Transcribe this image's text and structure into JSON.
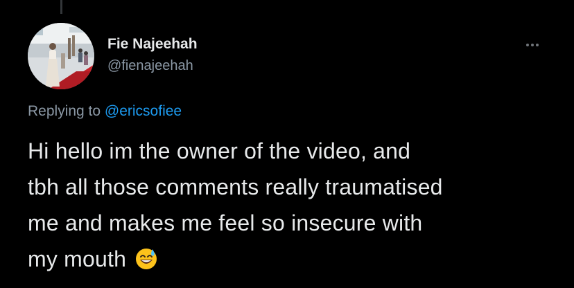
{
  "author": {
    "name": "Fie Najeehah",
    "handle": "@fienajeehah",
    "avatar_icon": "profile-photo"
  },
  "more_icon": "more-options-icon",
  "reply_context": {
    "prefix": "Replying to ",
    "mention": "@ericsofiee"
  },
  "tweet": {
    "lines": [
      "Hi hello im the owner of the video, and",
      "tbh all those comments really traumatised",
      "me and makes me feel so insecure with",
      "my mouth"
    ],
    "emoji": "grinning-face-with-sweat-emoji"
  },
  "colors": {
    "background": "#000000",
    "text_primary": "#e7e9ea",
    "text_secondary": "#8b98a5",
    "accent": "#1d9bf0"
  }
}
